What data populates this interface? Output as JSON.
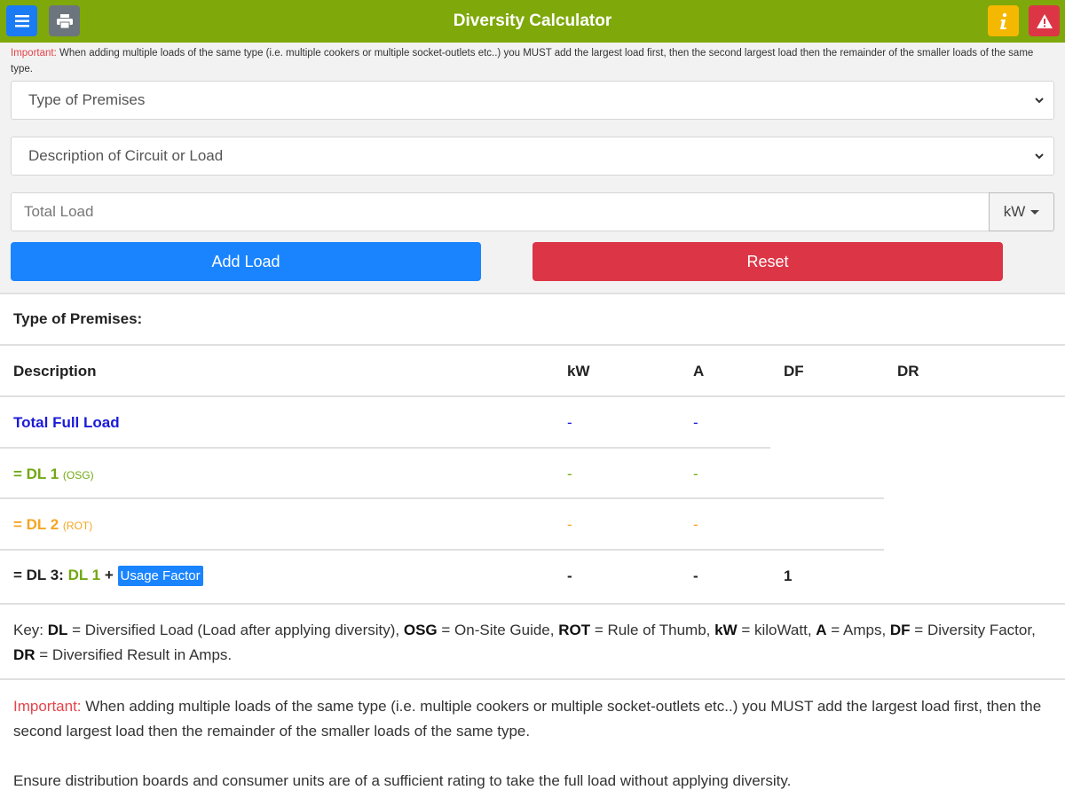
{
  "header": {
    "title": "Diversity Calculator",
    "colors": {
      "bar": "#7fa80a",
      "menu": "#1a7bf5",
      "print": "#6c757d",
      "info": "#f5b800",
      "alert": "#dc3545"
    },
    "icons": [
      "menu-icon",
      "print-icon",
      "info-icon",
      "alert-icon"
    ]
  },
  "top_note": {
    "important_label": "Important:",
    "text": " When adding multiple loads of the same type (i.e. multiple cookers or multiple socket-outlets etc..) you MUST add the largest load first, then the second largest load then the remainder of the smaller loads of the same type."
  },
  "form": {
    "premises_select": "Type of Premises",
    "load_select": "Description of Circuit or Load",
    "total_load_placeholder": "Total Load",
    "unit": "kW",
    "add_label": "Add Load",
    "reset_label": "Reset"
  },
  "results": {
    "premises_label": "Type of Premises:",
    "columns": [
      "Description",
      "kW",
      "A",
      "DF",
      "DR"
    ],
    "total_full_load": {
      "label": "Total Full Load",
      "kw": "-",
      "a": "-"
    },
    "dl1": {
      "prefix": "= DL 1",
      "source": "(OSG)",
      "kw": "-",
      "a": "-"
    },
    "dl2": {
      "prefix": "= DL 2",
      "source": "(ROT)",
      "kw": "-",
      "a": "-"
    },
    "dl3": {
      "prefix": "= DL 3:",
      "ref": "DL 1",
      "plus": "+",
      "badge": "Usage Factor",
      "kw": "-",
      "a": "-",
      "df": "1"
    }
  },
  "key": {
    "intro": "Key: ",
    "items": [
      {
        "abbr": "DL",
        "text": " = Diversified Load (Load after applying diversity), "
      },
      {
        "abbr": "OSG",
        "text": " = On-Site Guide, "
      },
      {
        "abbr": "ROT",
        "text": " = Rule of Thumb, "
      },
      {
        "abbr": "kW",
        "text": " = kiloWatt, "
      },
      {
        "abbr": "A",
        "text": " = Amps, "
      },
      {
        "abbr": "DF",
        "text": " = Diversity Factor, "
      },
      {
        "abbr": "DR",
        "text": " = Diversified Result in Amps."
      }
    ]
  },
  "bottom_note": {
    "important_label": "Important:",
    "text": " When adding multiple loads of the same type (i.e. multiple cookers or multiple socket-outlets etc..) you MUST add the largest load first, then the second largest load then the remainder of the smaller loads of the same type.",
    "ensure": "Ensure distribution boards and consumer units are of a sufficient rating to take the full load without applying diversity."
  }
}
